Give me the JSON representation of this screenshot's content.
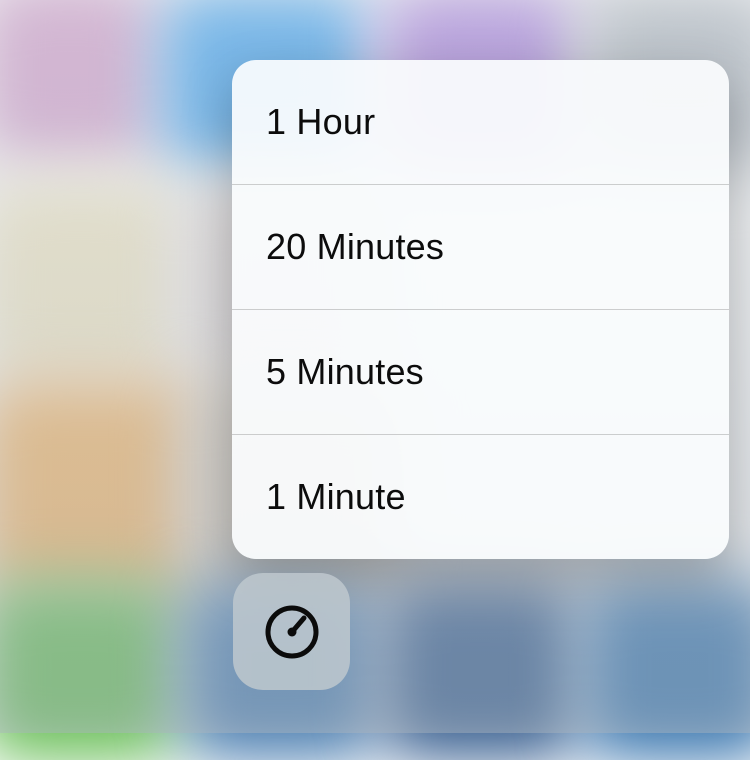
{
  "menu": {
    "items": [
      {
        "label": "1 Hour"
      },
      {
        "label": "20 Minutes"
      },
      {
        "label": "5 Minutes"
      },
      {
        "label": "1 Minute"
      }
    ]
  },
  "timer_button": {
    "icon": "timer-icon"
  }
}
